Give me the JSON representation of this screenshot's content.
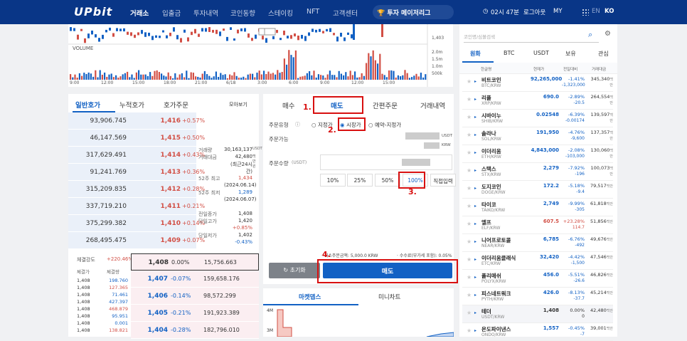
{
  "header": {
    "logo": "UPbit",
    "nav": [
      "거래소",
      "입출금",
      "투자내역",
      "코인동향",
      "스테이킹",
      "NFT",
      "고객센터"
    ],
    "center": "투자 메이저리그",
    "time": "02시 47분",
    "logout": "로그아웃",
    "my": "MY",
    "lang_en": "EN",
    "lang_ko": "KO"
  },
  "chart": {
    "volume_label": "VOLUME",
    "price_ticks": [
      "1,403"
    ],
    "volume_ticks": [
      "2.0m",
      "1.5m",
      "1.0m",
      "500k"
    ],
    "times": [
      "9:00",
      "12:00",
      "15:00",
      "18:00",
      "21:00",
      "6/18",
      "3:00",
      "6:00",
      "9:00",
      "12:00",
      "15:00"
    ]
  },
  "orderbook": {
    "tabs": [
      "일반호가",
      "누적호가",
      "호가주문"
    ],
    "view": "모아보기",
    "asks": [
      {
        "q": "93,906.745",
        "p": "1,416",
        "c": "+0.57%"
      },
      {
        "q": "46,147.569",
        "p": "1,415",
        "c": "+0.50%"
      },
      {
        "q": "317,629.491",
        "p": "1,414",
        "c": "+0.43%"
      },
      {
        "q": "91,241.769",
        "p": "1,413",
        "c": "+0.36%"
      },
      {
        "q": "315,209.835",
        "p": "1,412",
        "c": "+0.28%"
      },
      {
        "q": "337,719.210",
        "p": "1,411",
        "c": "+0.21%"
      },
      {
        "q": "375,299.382",
        "p": "1,410",
        "c": "+0.14%"
      },
      {
        "q": "268,495.475",
        "p": "1,409",
        "c": "+0.07%"
      }
    ],
    "bids": [
      {
        "p": "1,408",
        "c": "0.00%",
        "q": "15,756.663"
      },
      {
        "p": "1,407",
        "c": "-0.07%",
        "q": "159,658.176"
      },
      {
        "p": "1,406",
        "c": "-0.14%",
        "q": "98,572.299"
      },
      {
        "p": "1,405",
        "c": "-0.21%",
        "q": "191,923.389"
      },
      {
        "p": "1,404",
        "c": "-0.28%",
        "q": "182,796.010"
      }
    ],
    "strength_label": "체결강도",
    "strength": "+220.46%",
    "trade_head": [
      "체결가",
      "체결량"
    ],
    "trades": [
      [
        "1,408",
        "198.760"
      ],
      [
        "1,408",
        "127.365"
      ],
      [
        "1,408",
        "71.461"
      ],
      [
        "1,408",
        "427.397"
      ],
      [
        "1,408",
        "468.879"
      ],
      [
        "1,408",
        "95.951"
      ],
      [
        "1,408",
        "0.001"
      ],
      [
        "1,408",
        "138.821"
      ]
    ],
    "info": [
      [
        "거래량",
        "30,163,137",
        "USDT"
      ],
      [
        "거래대금",
        "42,480",
        "백만원"
      ],
      [
        "",
        "(최근24시간)",
        ""
      ],
      [
        "52주 최고",
        "1,434",
        ""
      ],
      [
        "",
        "(2024.06.14)",
        ""
      ],
      [
        "52주 최저",
        "1,289",
        ""
      ],
      [
        "",
        "(2024.06.07)",
        ""
      ],
      [
        "전일종가",
        "1,408",
        ""
      ],
      [
        "당일고가",
        "1,420",
        ""
      ],
      [
        "",
        "+0.85%",
        ""
      ],
      [
        "당일저가",
        "1,402",
        ""
      ],
      [
        "",
        "-0.43%",
        ""
      ]
    ]
  },
  "order": {
    "tabs": [
      "매수",
      "매도",
      "간편주문",
      "거래내역"
    ],
    "type_label": "주문유형",
    "types": [
      "지정가",
      "시장가",
      "예약-지정가"
    ],
    "avail_label": "주문가능",
    "avail_units": [
      "USDT",
      "KRW"
    ],
    "qty_label": "주문수량",
    "qty_unit": "(USDT)",
    "pcts": [
      "10%",
      "25%",
      "50%",
      "100%",
      "직접입력"
    ],
    "min": "최소주문금액: 5,000.0 KRW",
    "fee": "수수료(부가세 포함): 0.05%",
    "reset": "초기화",
    "submit": "매도"
  },
  "annotations": [
    "1.",
    "2.",
    "3.",
    "4."
  ],
  "market": {
    "tabs": [
      "마켓뎁스",
      "미니차트"
    ],
    "ticks": [
      "4M",
      "3M"
    ]
  },
  "sidebar": {
    "search_placeholder": "코인명/심볼검색",
    "tabs": [
      "원화",
      "BTC",
      "USDT",
      "보유",
      "관심"
    ],
    "cols": [
      "한글명",
      "현재가",
      "전일대비",
      "거래대금"
    ],
    "coins": [
      {
        "n": "비트코인",
        "s": "BTC/KRW",
        "p": "92,265,000",
        "c": "-1.41%",
        "d": "-1,323,000",
        "v": "345,340",
        "clr": "blue"
      },
      {
        "n": "리플",
        "s": "XRP/KRW",
        "p": "690.0",
        "c": "-2.89%",
        "d": "-20.5",
        "v": "264,554",
        "clr": "blue"
      },
      {
        "n": "시바이누",
        "s": "SHIB/KRW",
        "p": "0.02548",
        "c": "-6.39%",
        "d": "-0.00174",
        "v": "139,597",
        "clr": "blue"
      },
      {
        "n": "솔라나",
        "s": "SOL/KRW",
        "p": "191,950",
        "c": "-4.76%",
        "d": "-9,600",
        "v": "137,357",
        "clr": "blue"
      },
      {
        "n": "이더리움",
        "s": "ETH/KRW",
        "p": "4,843,000",
        "c": "-2.08%",
        "d": "-103,000",
        "v": "130,060",
        "clr": "blue"
      },
      {
        "n": "스택스",
        "s": "STX/KRW",
        "p": "2,279",
        "c": "-7.92%",
        "d": "-196",
        "v": "100,073",
        "clr": "blue"
      },
      {
        "n": "도지코인",
        "s": "DOGE/KRW",
        "p": "172.2",
        "c": "-5.18%",
        "d": "-9.4",
        "v": "79,517",
        "clr": "blue"
      },
      {
        "n": "타이코",
        "s": "TAIKO/KRW",
        "p": "2,749",
        "c": "-9.99%",
        "d": "-305",
        "v": "61,818",
        "clr": "blue"
      },
      {
        "n": "엘프",
        "s": "ELF/KRW",
        "p": "607.5",
        "c": "+23.28%",
        "d": "114.7",
        "v": "51,856",
        "clr": "red"
      },
      {
        "n": "니어프로토콜",
        "s": "NEAR/KRW",
        "p": "6,785",
        "c": "-6.76%",
        "d": "-492",
        "v": "49,676",
        "clr": "blue"
      },
      {
        "n": "이더리움클래식",
        "s": "ETC/KRW",
        "p": "32,420",
        "c": "-4.42%",
        "d": "-1,500",
        "v": "47,546",
        "clr": "blue"
      },
      {
        "n": "폴리매쉬",
        "s": "POLYX/KRW",
        "p": "456.0",
        "c": "-5.51%",
        "d": "-26.6",
        "v": "46,826",
        "clr": "blue"
      },
      {
        "n": "피스네트워크",
        "s": "PYTH/KRW",
        "p": "426.0",
        "c": "-8.13%",
        "d": "-37.7",
        "v": "45,214",
        "clr": "blue"
      },
      {
        "n": "테더",
        "s": "USDT/KRW",
        "p": "1,408",
        "c": "0.00%",
        "d": "0",
        "v": "42,480",
        "clr": "black"
      },
      {
        "n": "온도파이낸스",
        "s": "ONDO/KRW",
        "p": "1,557",
        "c": "-0.45%",
        "d": "-7",
        "v": "39,001",
        "clr": "blue"
      }
    ],
    "unit": "백만"
  }
}
